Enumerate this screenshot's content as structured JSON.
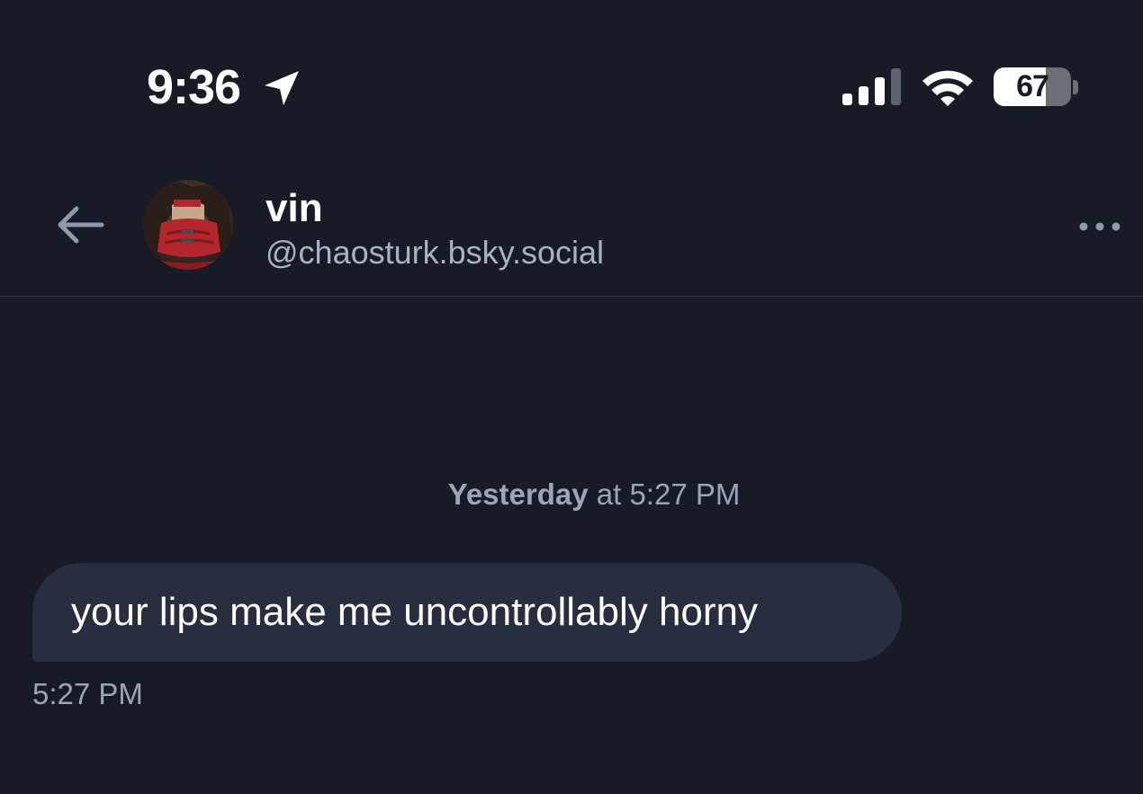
{
  "status_bar": {
    "time": "9:36",
    "battery_percent": "67",
    "battery_level": 0.67,
    "signal_bars_active": 3,
    "signal_bars_total": 4
  },
  "header": {
    "display_name": "vin",
    "handle": "@chaosturk.bsky.social"
  },
  "conversation": {
    "date_separator": {
      "day": "Yesterday",
      "rest": " at 5:27 PM"
    },
    "messages": [
      {
        "text": "your lips make me uncontrollably horny",
        "time": "5:27 PM"
      }
    ]
  },
  "icons": {
    "back": "arrow-left-icon",
    "more": "ellipsis-icon",
    "location": "location-arrow-icon",
    "signal": "cellular-signal-icon",
    "wifi": "wifi-icon",
    "battery": "battery-icon"
  },
  "colors": {
    "background": "#161b26",
    "bubble": "#262e3f",
    "secondary_text": "#9ba5b7",
    "handle_text": "#a9b2c3",
    "icon_muted": "#8e99ad"
  }
}
